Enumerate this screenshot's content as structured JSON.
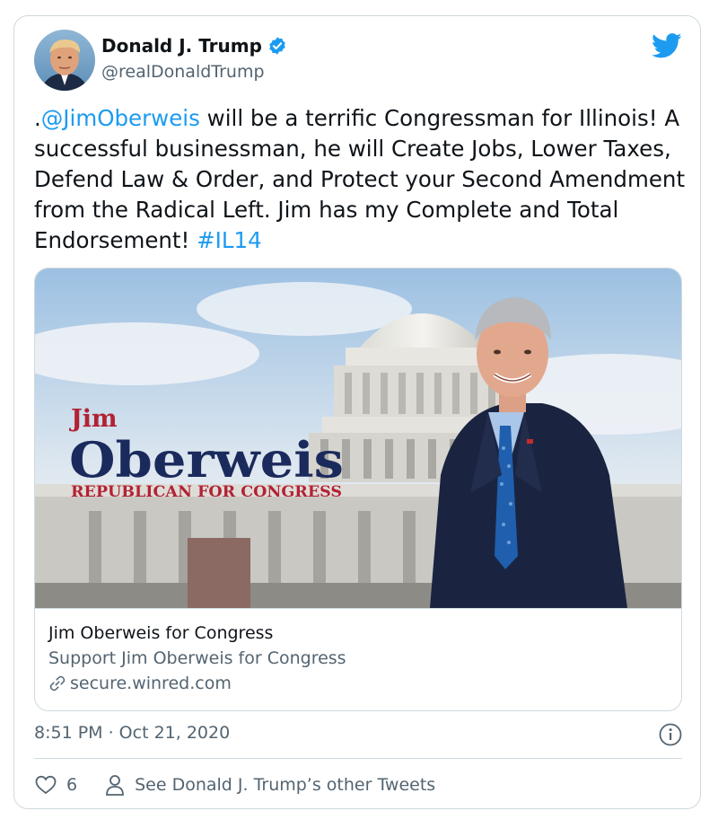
{
  "author": {
    "name": "Donald J. Trump",
    "handle": "@realDonaldTrump",
    "verified": true
  },
  "tweet": {
    "prefix": ".",
    "mention": "@JimOberweis",
    "body": " will be a terrific Congressman for Illinois! A successful businessman, he will Create Jobs, Lower Taxes, Defend Law & Order, and Protect your Second Amendment from the Radical Left. Jim has my Complete and Total Endorsement! ",
    "hashtag": "#IL14"
  },
  "card": {
    "logo_first": "Jim",
    "logo_last": "Oberweis",
    "logo_tagline": "REPUBLICAN FOR CONGRESS",
    "title": "Jim Oberweis for Congress",
    "description": "Support Jim Oberweis for Congress",
    "url": "secure.winred.com"
  },
  "timestamp": "8:51 PM · Oct 21, 2020",
  "likes": "6",
  "other_tweets_label": "See Donald J. Trump’s other Tweets",
  "colors": {
    "accent": "#1d9bf0",
    "text": "#0f1419",
    "muted": "#536471",
    "border": "#cfd9de",
    "logo_red": "#b22234",
    "logo_navy": "#1b2a5c"
  },
  "icons": [
    "twitter-bird-icon",
    "verified-badge-icon",
    "link-icon",
    "info-icon",
    "heart-icon",
    "person-icon"
  ]
}
